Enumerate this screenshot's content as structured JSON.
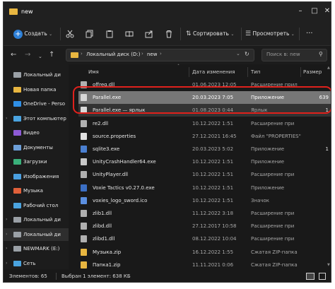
{
  "window": {
    "title": "new"
  },
  "toolbar": {
    "create_label": "Создать",
    "sort_label": "Сортировать",
    "view_label": "Просмотреть",
    "more_label": "···"
  },
  "address": {
    "path": [
      "Локальный диск (D:)",
      "new"
    ],
    "search_placeholder": "Поиск в: new"
  },
  "sidebar": {
    "items": [
      {
        "label": "Локальный ди",
        "icon": "drive-icon",
        "color": "#9aa0a6"
      },
      {
        "label": "Новая папка",
        "icon": "folder-icon",
        "color": "#e8b640"
      },
      {
        "label": "OneDrive - Perso",
        "icon": "cloud-icon",
        "color": "#2f8fe6"
      },
      {
        "label": "Этот компьютер",
        "icon": "computer-icon",
        "color": "#4aa3df"
      },
      {
        "label": "Видео",
        "icon": "video-icon",
        "color": "#8e5bd6"
      },
      {
        "label": "Документы",
        "icon": "documents-icon",
        "color": "#6d9fd8"
      },
      {
        "label": "Загрузки",
        "icon": "downloads-icon",
        "color": "#3ab07a"
      },
      {
        "label": "Изображения",
        "icon": "images-icon",
        "color": "#4a9fe0"
      },
      {
        "label": "Музыка",
        "icon": "music-icon",
        "color": "#e0603a"
      },
      {
        "label": "Рабочий стол",
        "icon": "desktop-icon",
        "color": "#4aa3df"
      },
      {
        "label": "Локальный ди",
        "icon": "drive-icon",
        "color": "#9aa0a6"
      },
      {
        "label": "Локальный ди",
        "icon": "drive-icon",
        "color": "#9aa0a6"
      },
      {
        "label": "NEWMARK (E:)",
        "icon": "usb-drive-icon",
        "color": "#9aa0a6"
      },
      {
        "label": "Сеть",
        "icon": "network-icon",
        "color": "#4aa3df"
      }
    ]
  },
  "columns": {
    "name": "Имя",
    "date": "Дата изменения",
    "type": "Тип",
    "size": "Размер"
  },
  "files": [
    {
      "name": "offreg.dll",
      "date": "01.06.2023 12:05",
      "type": "Расширение прил",
      "size": "",
      "icon": "dll-icon",
      "color": "#b0b0b0"
    },
    {
      "name": "Parallel.exe",
      "date": "20.03.2023 7:05",
      "type": "Приложение",
      "size": "639",
      "icon": "exe-icon",
      "color": "#d8d8d8"
    },
    {
      "name": "Parallel.exe — ярлык",
      "date": "01.08.2023 0:44",
      "type": "Ярлык",
      "size": "1",
      "icon": "shortcut-icon",
      "color": "#d8d8d8"
    },
    {
      "name": "re2.dll",
      "date": "10.12.2022 1:51",
      "type": "Расширение при",
      "size": "",
      "icon": "dll-icon",
      "color": "#b0b0b0"
    },
    {
      "name": "source.properties",
      "date": "27.12.2021 16:45",
      "type": "Файл \"PROPERTIES\"",
      "size": "",
      "icon": "file-icon",
      "color": "#e0e0e0"
    },
    {
      "name": "sqlite3.exe",
      "date": "20.03.2023 5:02",
      "type": "Приложение",
      "size": "1",
      "icon": "exe-icon",
      "color": "#4a7fd0"
    },
    {
      "name": "UnityCrashHandler64.exe",
      "date": "10.12.2022 1:51",
      "type": "Приложение",
      "size": "",
      "icon": "exe-icon",
      "color": "#c8c8c8"
    },
    {
      "name": "UnityPlayer.dll",
      "date": "10.12.2022 1:51",
      "type": "Расширение при",
      "size": "",
      "icon": "dll-icon",
      "color": "#b0b0b0"
    },
    {
      "name": "Voxie Tactics v0.27.0.exe",
      "date": "10.12.2022 1:51",
      "type": "Приложение",
      "size": "",
      "icon": "exe-icon",
      "color": "#3b6fc4"
    },
    {
      "name": "voxies_logo_sword.ico",
      "date": "10.12.2022 1:51",
      "type": "Значок",
      "size": "",
      "icon": "ico-icon",
      "color": "#5b8fe0"
    },
    {
      "name": "zlib1.dll",
      "date": "11.12.2022 3:18",
      "type": "Расширение при",
      "size": "",
      "icon": "dll-icon",
      "color": "#b0b0b0"
    },
    {
      "name": "zlibd.dll",
      "date": "27.12.2017 10:58",
      "type": "Расширение при",
      "size": "",
      "icon": "dll-icon",
      "color": "#b0b0b0"
    },
    {
      "name": "zlibd1.dll",
      "date": "08.12.2022 10:04",
      "type": "Расширение при",
      "size": "",
      "icon": "dll-icon",
      "color": "#b0b0b0"
    },
    {
      "name": "Музыка.zip",
      "date": "16.12.2022 1:55",
      "type": "Сжатая ZIP-папка",
      "size": "",
      "icon": "zip-icon",
      "color": "#e8b640"
    },
    {
      "name": "Папка1.zip",
      "date": "11.11.2021 0:06",
      "type": "Сжатая ZIP-папка",
      "size": "",
      "icon": "zip-icon",
      "color": "#e8b640"
    }
  ],
  "status": {
    "count": "Элементов: 65",
    "selected": "Выбран 1 элемент: 638 КБ"
  },
  "colors": {
    "highlight": "#e0211c",
    "selection": "#777777",
    "background": "#191919"
  }
}
